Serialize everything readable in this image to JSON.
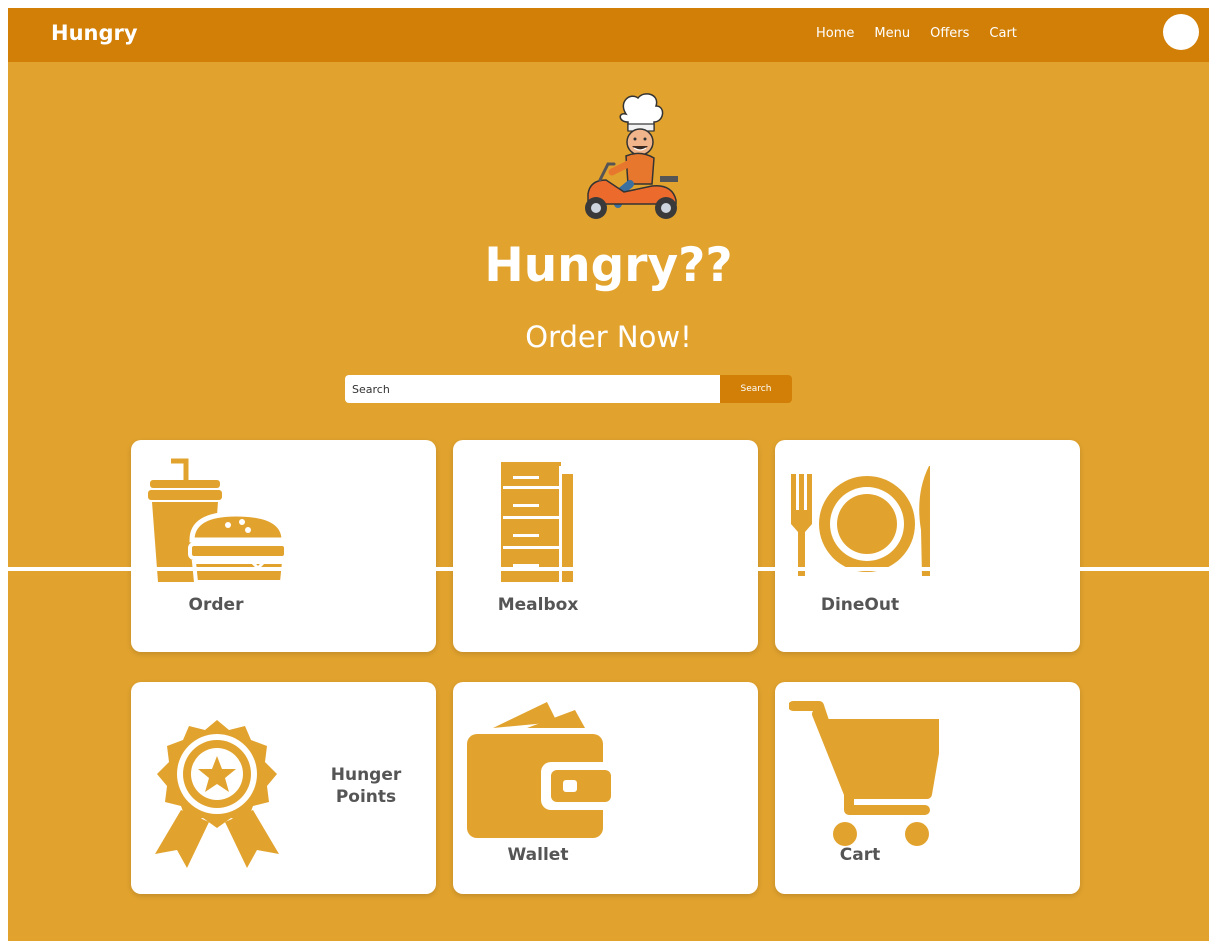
{
  "navbar": {
    "brand": "Hungry",
    "links": [
      "Home",
      "Menu",
      "Offers",
      "Cart"
    ]
  },
  "hero": {
    "title": "Hungry??",
    "subtitle": "Order Now!"
  },
  "search": {
    "placeholder": "Search",
    "button_label": "Search"
  },
  "cards": [
    {
      "label": "Order",
      "icon": "fast-food-icon"
    },
    {
      "label": "Mealbox",
      "icon": "mealbox-icon"
    },
    {
      "label": "DineOut",
      "icon": "cutlery-icon"
    },
    {
      "label": "Hunger Points",
      "icon": "award-badge-icon"
    },
    {
      "label": "Wallet",
      "icon": "wallet-icon"
    },
    {
      "label": "Cart",
      "icon": "shopping-cart-icon"
    }
  ],
  "colors": {
    "page_bg": "#e2a32e",
    "navbar_bg": "#d17f07",
    "icon": "#e2a32e",
    "card_text": "#555555"
  }
}
